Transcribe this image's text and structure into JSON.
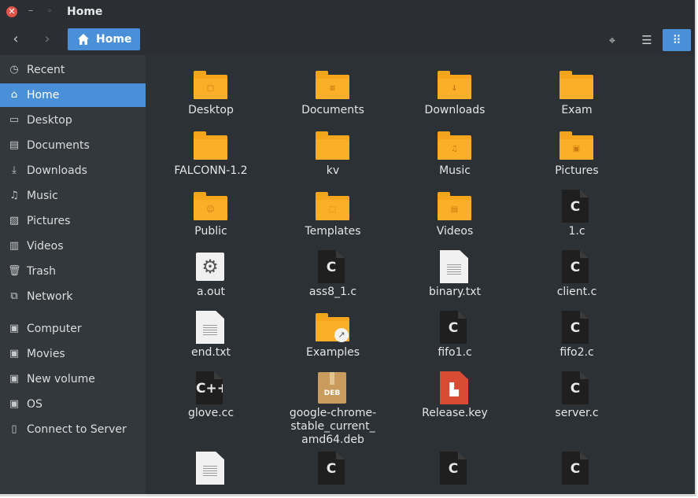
{
  "window": {
    "title": "Home"
  },
  "toolbar": {
    "path_label": "Home",
    "icons": {
      "back": "chevron-left-icon",
      "forward": "chevron-right-icon",
      "location": "target-icon",
      "list_view": "list-icon",
      "grid_view": "grid-icon"
    }
  },
  "sidebar": {
    "items": [
      {
        "label": "Recent",
        "icon": "clock-icon"
      },
      {
        "label": "Home",
        "icon": "home-icon",
        "active": true
      },
      {
        "label": "Desktop",
        "icon": "desktop-icon"
      },
      {
        "label": "Documents",
        "icon": "document-icon"
      },
      {
        "label": "Downloads",
        "icon": "download-icon"
      },
      {
        "label": "Music",
        "icon": "music-icon"
      },
      {
        "label": "Pictures",
        "icon": "picture-icon"
      },
      {
        "label": "Videos",
        "icon": "video-icon"
      },
      {
        "label": "Trash",
        "icon": "trash-icon"
      },
      {
        "label": "Network",
        "icon": "network-icon"
      },
      {
        "label": "Computer",
        "icon": "drive-icon"
      },
      {
        "label": "Movies",
        "icon": "drive-icon"
      },
      {
        "label": "New volume",
        "icon": "drive-icon"
      },
      {
        "label": "OS",
        "icon": "drive-icon"
      },
      {
        "label": "Connect to Server",
        "icon": "server-icon"
      }
    ]
  },
  "files": [
    {
      "name": "Desktop",
      "kind": "folder",
      "emblem": "▢"
    },
    {
      "name": "Documents",
      "kind": "folder",
      "emblem": "≡"
    },
    {
      "name": "Downloads",
      "kind": "folder",
      "emblem": "↓"
    },
    {
      "name": "Exam",
      "kind": "folder",
      "emblem": ""
    },
    {
      "name": "FALCONN-1.2",
      "kind": "folder",
      "emblem": ""
    },
    {
      "name": "kv",
      "kind": "folder",
      "emblem": ""
    },
    {
      "name": "Music",
      "kind": "folder",
      "emblem": "♫"
    },
    {
      "name": "Pictures",
      "kind": "folder",
      "emblem": "▣"
    },
    {
      "name": "Public",
      "kind": "folder",
      "emblem": "☺"
    },
    {
      "name": "Templates",
      "kind": "folder",
      "emblem": "⬚"
    },
    {
      "name": "Videos",
      "kind": "folder",
      "emblem": "▤"
    },
    {
      "name": "1.c",
      "kind": "c",
      "emblem": "C"
    },
    {
      "name": "a.out",
      "kind": "exec",
      "emblem": "⚙"
    },
    {
      "name": "ass8_1.c",
      "kind": "c",
      "emblem": "C"
    },
    {
      "name": "binary.txt",
      "kind": "txt",
      "emblem": ""
    },
    {
      "name": "client.c",
      "kind": "c",
      "emblem": "C"
    },
    {
      "name": "end.txt",
      "kind": "txt",
      "emblem": ""
    },
    {
      "name": "Examples",
      "kind": "examples",
      "emblem": "↗"
    },
    {
      "name": "fifo1.c",
      "kind": "c",
      "emblem": "C"
    },
    {
      "name": "fifo2.c",
      "kind": "c",
      "emblem": "C"
    },
    {
      "name": "glove.cc",
      "kind": "c",
      "emblem": "C++"
    },
    {
      "name": "google-chrome-stable_current_amd64.deb",
      "kind": "deb",
      "emblem": "DEB"
    },
    {
      "name": "Release.key",
      "kind": "key",
      "emblem": "▙"
    },
    {
      "name": "server.c",
      "kind": "c",
      "emblem": "C"
    },
    {
      "name": "",
      "kind": "txt",
      "emblem": ""
    },
    {
      "name": "",
      "kind": "c",
      "emblem": "C"
    },
    {
      "name": "",
      "kind": "c",
      "emblem": "C"
    },
    {
      "name": "",
      "kind": "c",
      "emblem": "C"
    }
  ],
  "colors": {
    "accent": "#4a90d9",
    "folder": "#f7a51c",
    "sidebar_bg": "#33383d",
    "content_bg": "#2c3136"
  }
}
